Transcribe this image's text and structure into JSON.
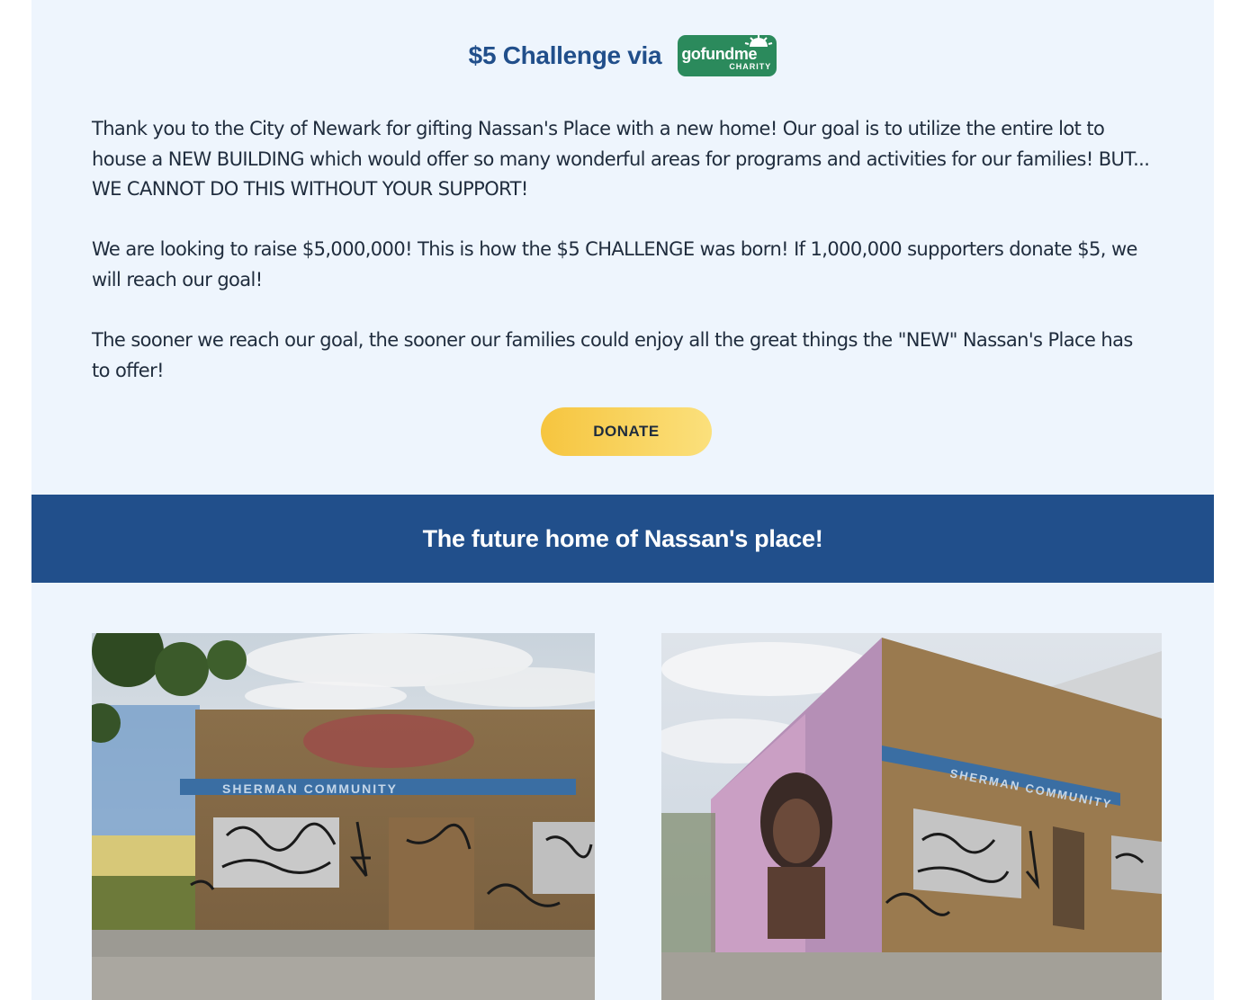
{
  "challenge": {
    "title": "$5 Challenge via",
    "logo_word": "gofundme",
    "logo_sub": "CHARITY"
  },
  "paragraphs": [
    "Thank you to the City of Newark for gifting Nassan's Place with a new home!  Our goal is to utilize the entire lot to house a NEW BUILDING which would offer so many wonderful areas for programs and activities for our families!  BUT... WE CANNOT DO THIS WITHOUT YOUR SUPPORT!",
    "We are looking to raise $5,000,000!  This is how the $5 CHALLENGE was born!  If 1,000,000 supporters donate $5, we will reach our goal!",
    "The sooner we reach our goal, the sooner our families could enjoy all the great things the \"NEW\" Nassan's Place has to offer!"
  ],
  "donate_label": "DONATE",
  "banner_title": "The future home of Nassan's place!",
  "photos": {
    "left_sign": "SHERMAN COMMUNITY",
    "right_sign": "SHERMAN COMMUNITY"
  },
  "colors": {
    "page_bg": "#eef5fd",
    "brand_blue": "#214f8b",
    "gofundme_green": "#2b8a5c",
    "donate_yellow": "#f6c53f",
    "text": "#1f2c3d"
  }
}
